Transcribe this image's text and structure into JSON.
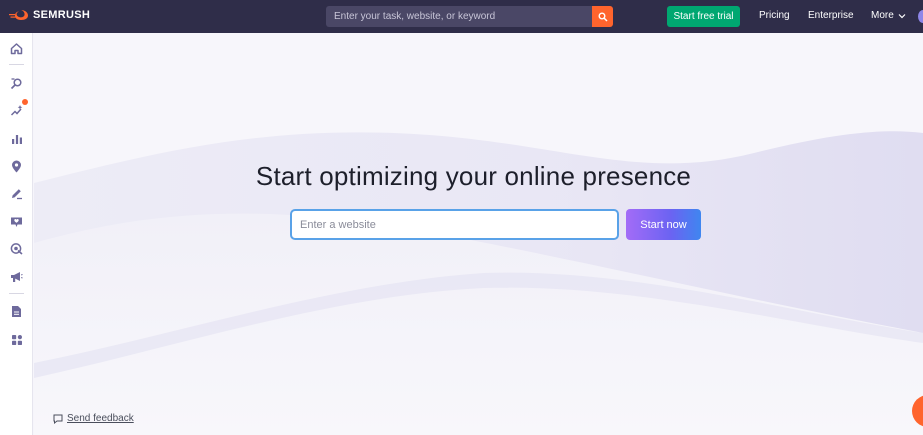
{
  "header": {
    "logo_text": "SEMRUSH",
    "search_placeholder": "Enter your task, website, or keyword",
    "trial_label": "Start free trial",
    "nav": {
      "pricing": "Pricing",
      "enterprise": "Enterprise",
      "more": "More"
    }
  },
  "sidebar": {
    "icons": [
      "home-icon",
      "keyword-research-icon",
      "ai-sparkle-icon",
      "analytics-icon",
      "local-pin-icon",
      "content-edit-icon",
      "reputation-icon",
      "ads-target-icon",
      "social-megaphone-icon",
      "reports-icon",
      "apps-grid-icon"
    ]
  },
  "main": {
    "headline": "Start optimizing your online presence",
    "input_placeholder": "Enter a website",
    "cta_label": "Start now",
    "feedback_label": "Send feedback"
  },
  "colors": {
    "topbar": "#2f2d49",
    "accent_orange": "#ff642d",
    "trial_green": "#00a771",
    "input_border": "#59a2e8"
  }
}
